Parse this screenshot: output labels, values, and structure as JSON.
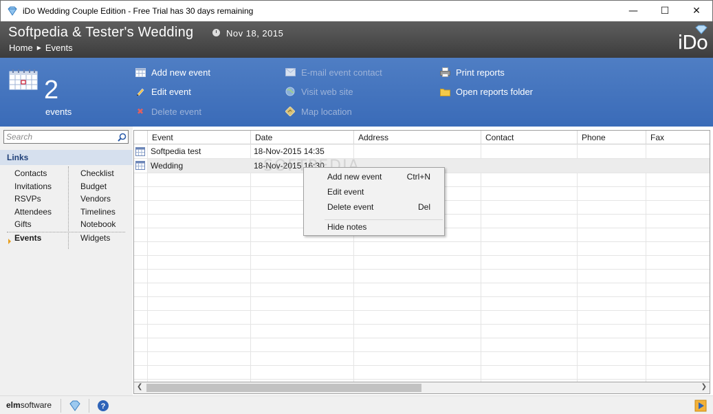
{
  "window": {
    "title": "iDo Wedding Couple Edition - Free Trial has 30 days remaining",
    "controls": [
      "minimize",
      "maximize",
      "close"
    ]
  },
  "header": {
    "wedding_title": "Softpedia & Tester's Wedding",
    "date": "Nov 18, 2015",
    "breadcrumb": [
      "Home",
      "Events"
    ],
    "logo_text": "iDo"
  },
  "toolbar": {
    "event_count": "2",
    "event_count_label": "events",
    "actions": [
      {
        "label": "Add new event",
        "icon": "calendar-add-icon",
        "enabled": true
      },
      {
        "label": "Edit event",
        "icon": "pencil-icon",
        "enabled": true
      },
      {
        "label": "Delete event",
        "icon": "delete-x-icon",
        "enabled": false
      },
      {
        "label": "E-mail event contact",
        "icon": "email-icon",
        "enabled": false
      },
      {
        "label": "Visit web site",
        "icon": "globe-icon",
        "enabled": false
      },
      {
        "label": "Map location",
        "icon": "map-sign-icon",
        "enabled": false
      },
      {
        "label": "Print reports",
        "icon": "printer-icon",
        "enabled": true
      },
      {
        "label": "Open reports folder",
        "icon": "folder-icon",
        "enabled": true
      }
    ]
  },
  "sidebar": {
    "search_placeholder": "Search",
    "links_header": "Links",
    "col1": [
      "Contacts",
      "Invitations",
      "RSVPs",
      "Attendees",
      "Gifts",
      "Events"
    ],
    "col2": [
      "Checklist",
      "Budget",
      "Vendors",
      "Timelines",
      "Notebook",
      "Widgets"
    ],
    "active": "Events"
  },
  "grid": {
    "columns": [
      "Event",
      "Date",
      "Address",
      "Contact",
      "Phone",
      "Fax"
    ],
    "rows": [
      {
        "event": "Softpedia test",
        "date": "18-Nov-2015 14:35",
        "address": "",
        "contact": "",
        "phone": "",
        "fax": ""
      },
      {
        "event": "Wedding",
        "date": "18-Nov-2015 16:30",
        "address": "",
        "contact": "",
        "phone": "",
        "fax": ""
      }
    ]
  },
  "context_menu": {
    "items": [
      {
        "label": "Add new event",
        "shortcut": "Ctrl+N"
      },
      {
        "label": "Edit event",
        "shortcut": ""
      },
      {
        "label": "Delete event",
        "shortcut": "Del"
      },
      {
        "label": "Hide notes",
        "shortcut": ""
      }
    ]
  },
  "watermark": "SOFTPEDIA",
  "statusbar": {
    "brand_prefix": "elm",
    "brand_suffix": "software"
  },
  "colors": {
    "toolbar_blue": "#3f70bc",
    "header_gray": "#4d4d4d",
    "links_header_bg": "#d6e0ee",
    "active_arrow": "#e8a020"
  }
}
